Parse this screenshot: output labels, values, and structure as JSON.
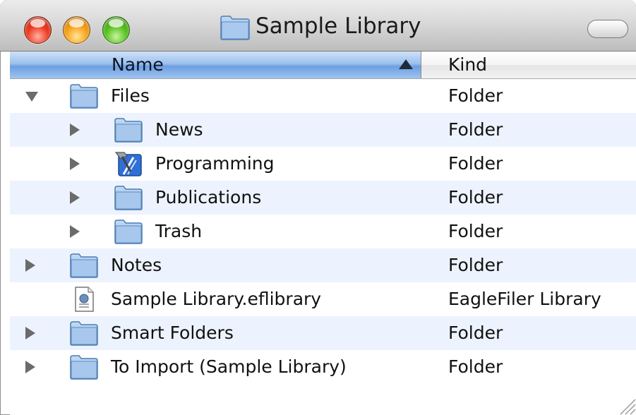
{
  "window": {
    "title": "Sample Library"
  },
  "columns": {
    "name": "Name",
    "kind": "Kind",
    "sort_direction": "ascending"
  },
  "rows": [
    {
      "name": "Files",
      "kind": "Folder",
      "level": 0,
      "disclosure": "open",
      "icon": "folder-icon",
      "alt": false
    },
    {
      "name": "News",
      "kind": "Folder",
      "level": 1,
      "disclosure": "closed",
      "icon": "folder-icon",
      "alt": true
    },
    {
      "name": "Programming",
      "kind": "Folder",
      "level": 1,
      "disclosure": "closed",
      "icon": "xcode-hammer-icon",
      "alt": false
    },
    {
      "name": "Publications",
      "kind": "Folder",
      "level": 1,
      "disclosure": "closed",
      "icon": "folder-icon",
      "alt": true
    },
    {
      "name": "Trash",
      "kind": "Folder",
      "level": 1,
      "disclosure": "closed",
      "icon": "folder-icon",
      "alt": false
    },
    {
      "name": "Notes",
      "kind": "Folder",
      "level": 0,
      "disclosure": "closed",
      "icon": "folder-icon",
      "alt": true
    },
    {
      "name": "Sample Library.eflibrary",
      "kind": "EagleFiler Library",
      "level": 0,
      "disclosure": "none",
      "icon": "document-icon",
      "alt": false
    },
    {
      "name": "Smart Folders",
      "kind": "Folder",
      "level": 0,
      "disclosure": "closed",
      "icon": "folder-icon",
      "alt": true
    },
    {
      "name": "To Import (Sample Library)",
      "kind": "Folder",
      "level": 0,
      "disclosure": "closed",
      "icon": "folder-icon",
      "alt": false
    }
  ],
  "colors": {
    "header_selected": "#6f9fe1",
    "row_alternate": "#edf3fe",
    "folder_blue": "#8fb8e6"
  }
}
